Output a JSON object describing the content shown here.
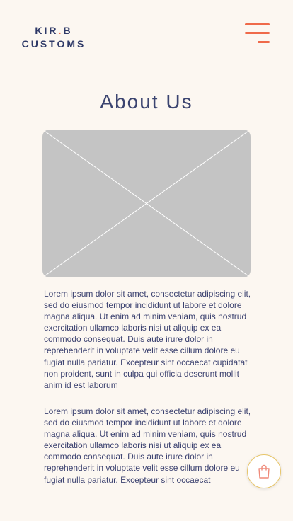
{
  "header": {
    "logo_line1_part1": "KIR",
    "logo_dot": ".",
    "logo_line1_part2": "B",
    "logo_line2": "CUSTOMS",
    "menu_icon": "hamburger-menu-icon"
  },
  "page": {
    "title": "About Us",
    "image_placeholder_icon": "image-placeholder-icon",
    "paragraphs": [
      "Lorem ipsum dolor sit amet, consectetur adipiscing elit, sed do eiusmod tempor incididunt ut labore et dolore magna aliqua. Ut enim ad minim veniam, quis nostrud exercitation ullamco laboris nisi ut aliquip ex ea commodo consequat. Duis aute irure dolor in reprehenderit in voluptate velit esse cillum dolore eu fugiat nulla pariatur. Excepteur sint occaecat cupidatat non proident, sunt in culpa qui officia deserunt mollit anim id est laborum",
      "Lorem ipsum dolor sit amet, consectetur adipiscing elit, sed do eiusmod tempor incididunt ut labore et dolore magna aliqua. Ut enim ad minim veniam, quis nostrud exercitation ullamco laboris nisi ut aliquip ex ea commodo consequat. Duis aute irure dolor in reprehenderit in voluptate velit esse cillum dolore eu fugiat nulla pariatur. Excepteur sint occaecat"
    ]
  },
  "cart": {
    "icon": "shopping-bag-icon"
  },
  "colors": {
    "background": "#fcf7f1",
    "navy": "#2f3a68",
    "accent": "#ef6a4a",
    "placeholder": "#c4c4c4",
    "cart_border": "#e8c66a"
  }
}
